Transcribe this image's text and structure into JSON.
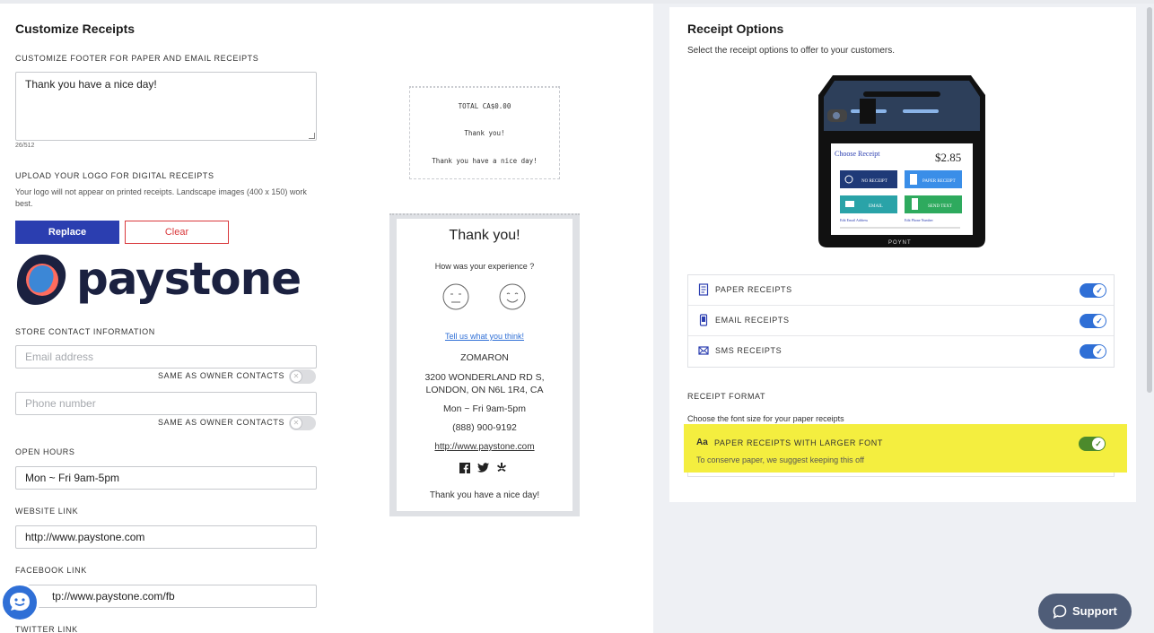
{
  "customize": {
    "title": "Customize Receipts",
    "footer_label": "CUSTOMIZE FOOTER FOR PAPER AND EMAIL RECEIPTS",
    "footer_value": "Thank you have a nice day!",
    "char_count": "26/512",
    "upload_label": "UPLOAD YOUR LOGO FOR DIGITAL RECEIPTS",
    "upload_help": "Your logo will not appear on printed receipts. Landscape images (400 x 150) work best.",
    "replace_label": "Replace",
    "clear_label": "Clear",
    "logo_text": "paystone",
    "contact_label": "STORE CONTACT INFORMATION",
    "email_placeholder": "Email address",
    "same_as_owner_1": "SAME AS OWNER CONTACTS",
    "phone_placeholder": "Phone number",
    "same_as_owner_2": "SAME AS OWNER CONTACTS",
    "hours_label": "OPEN HOURS",
    "hours_value": "Mon ~ Fri 9am-5pm",
    "website_label": "WEBSITE LINK",
    "website_value": "http://www.paystone.com",
    "facebook_label": "FACEBOOK LINK",
    "facebook_value": "tp://www.paystone.com/fb",
    "twitter_label": "TWITTER LINK"
  },
  "paper_preview": {
    "total": "TOTAL CA$0.00",
    "thanks": "Thank you!",
    "footer": "Thank you have a nice day!"
  },
  "digital_preview": {
    "title": "Thank you!",
    "question": "How was your experience ?",
    "link": "Tell us what you think!",
    "store": "ZOMARON",
    "address_1": "3200 WONDERLAND RD S,",
    "address_2": "LONDON, ON N6L 1R4, CA",
    "hours": "Mon ~ Fri 9am-5pm",
    "phone": "(888) 900-9192",
    "url": "http://www.paystone.com",
    "footer": "Thank you have a nice day!"
  },
  "options": {
    "title": "Receipt Options",
    "subtitle": "Select the receipt options to offer to your customers.",
    "device": {
      "choose": "Choose Receipt",
      "amount": "$2.85",
      "no_receipt": "NO RECEIPT",
      "paper_receipt": "PAPER RECEIPT",
      "email": "EMAIL",
      "send_text": "SEND TEXT",
      "edit_email": "Edit Email Address",
      "edit_phone": "Edit Phone Number",
      "brand": "POYNT"
    },
    "items": [
      {
        "label": "PAPER RECEIPTS",
        "enabled": true,
        "icon": "receipt-icon"
      },
      {
        "label": "EMAIL RECEIPTS",
        "enabled": true,
        "icon": "phone-icon"
      },
      {
        "label": "SMS RECEIPTS",
        "enabled": true,
        "icon": "envelope-icon"
      }
    ],
    "format_label": "RECEIPT FORMAT",
    "format_help": "Choose the font size for your paper receipts",
    "large_font_label": "PAPER RECEIPTS WITH LARGER FONT",
    "large_font_help": "To conserve paper, we suggest keeping this off",
    "large_font_enabled": true
  },
  "support_label": "Support",
  "colors": {
    "primary": "#2b3eb0",
    "toggle_on": "#2f6fd6",
    "toggle_green": "#4c8a2c",
    "highlight": "#f4ee3f",
    "danger": "#d9383b"
  }
}
